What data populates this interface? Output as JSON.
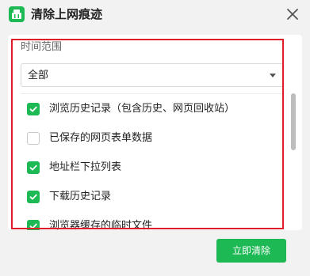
{
  "dialog": {
    "title": "清除上网痕迹",
    "accent_color": "#1db954",
    "icon": "app-brush-icon",
    "close_icon": "close-icon"
  },
  "time_range": {
    "label": "时间范围",
    "selected": "全部"
  },
  "options": [
    {
      "label": "浏览历史记录（包含历史、网页回收站）",
      "checked": true
    },
    {
      "label": "已保存的网页表单数据",
      "checked": false
    },
    {
      "label": "地址栏下拉列表",
      "checked": true
    },
    {
      "label": "下载历史记录",
      "checked": true
    },
    {
      "label": "浏览器缓存的临时文件",
      "checked": true
    }
  ],
  "actions": {
    "confirm_label": "立即清除"
  }
}
